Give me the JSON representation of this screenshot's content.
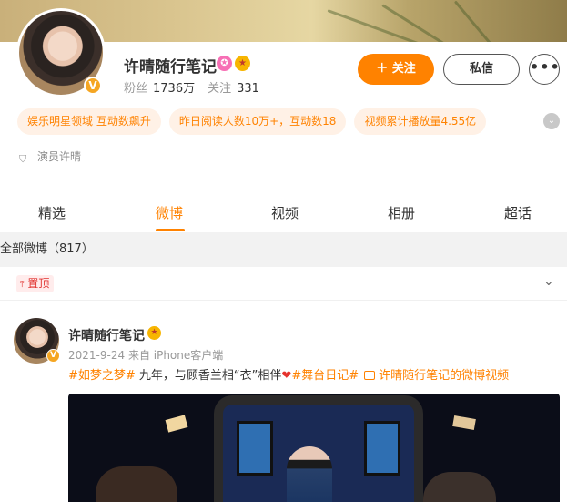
{
  "profile": {
    "name": "许晴随行笔记",
    "verified_mark": "V",
    "badge_icons": [
      "pink-badge-icon",
      "gold-badge-icon"
    ],
    "followers_label": "粉丝",
    "followers_value": "1736万",
    "following_label": "关注",
    "following_value": "331",
    "follow_button": "＋ 关注",
    "message_button": "私信",
    "more_button": "•••",
    "chips": [
      "娱乐明星领域 互动数飙升",
      "昨日阅读人数10万+，互动数18",
      "视频累计播放量4.55亿"
    ],
    "chip_toggle_icon": "chevron-down-icon",
    "verification": "演员许晴"
  },
  "tabs": [
    {
      "label": "精选",
      "active": false
    },
    {
      "label": "微博",
      "active": true
    },
    {
      "label": "视频",
      "active": false
    },
    {
      "label": "相册",
      "active": false
    },
    {
      "label": "超话",
      "active": false
    }
  ],
  "feed": {
    "all_count": "全部微博（817）",
    "pinned_label": "置顶"
  },
  "post": {
    "author": "许晴随行笔记",
    "verified_mark": "V",
    "date": "2021-9-24",
    "source": "来自 iPhone客户端",
    "tag1": "#如梦之梦#",
    "text": " 九年，与顾香兰相“衣”相伴",
    "heart": "❤",
    "tag2": "#舞台日记#",
    "video_link": "许晴随行笔记的微博视频"
  },
  "colors": {
    "accent": "#ff8200",
    "chip_bg": "#fff1e6",
    "pin_red": "#e0302d"
  }
}
